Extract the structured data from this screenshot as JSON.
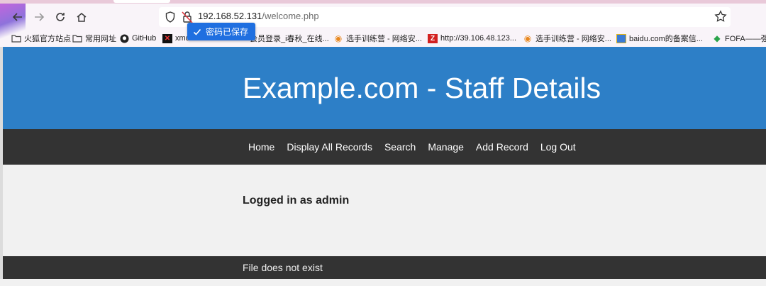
{
  "browser": {
    "url_host": "192.168.52.131",
    "url_path": "/welcome.php",
    "password_toast": "密码已保存",
    "bookmarks": [
      {
        "label": "火狐官方站点",
        "icon": "folder-icon"
      },
      {
        "label": "常用网址",
        "icon": "folder-icon"
      },
      {
        "label": "GitHub",
        "icon": "github-icon"
      },
      {
        "label": "xmc",
        "icon": "x-icon"
      },
      {
        "label": "会员登录_i春秋_在线...",
        "icon": "none"
      },
      {
        "label": "选手训练营 - 网络安...",
        "icon": "flame-icon"
      },
      {
        "label": "http://39.106.48.123...",
        "icon": "z-icon"
      },
      {
        "label": "选手训练营 - 网络安...",
        "icon": "flame-icon"
      },
      {
        "label": "baidu.com的备案信...",
        "icon": "page-icon"
      },
      {
        "label": "FOFA——强大",
        "icon": "fofa-icon"
      }
    ]
  },
  "page": {
    "title": "Example.com - Staff Details",
    "nav": [
      "Home",
      "Display All Records",
      "Search",
      "Manage",
      "Add Record",
      "Log Out"
    ],
    "logged_in": "Logged in as admin",
    "footer": "File does not exist"
  },
  "colors": {
    "header_bg": "#2d7fc7",
    "nav_bg": "#333333",
    "toast_bg": "#1f6fe0"
  }
}
